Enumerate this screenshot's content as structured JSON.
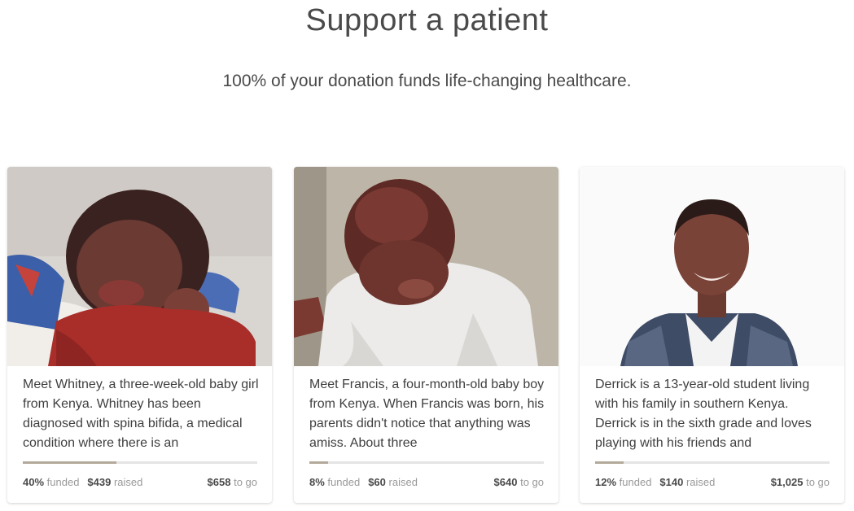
{
  "page": {
    "title": "Support a patient",
    "subtitle": "100% of your donation funds life-changing healthcare."
  },
  "cards": [
    {
      "name": "Whitney",
      "description": "Meet Whitney, a three-week-old baby girl from Kenya. Whitney has been diagnosed with spina bifida, a medical condition where there is an",
      "funded_pct": "40%",
      "funded_label": "funded",
      "raised_amount": "$439",
      "raised_label": "raised",
      "to_go_amount": "$658",
      "to_go_label": "to go",
      "progress_fraction": 0.4
    },
    {
      "name": "Francis",
      "description": "Meet Francis, a four-month-old baby boy from Kenya. When Francis was born, his parents didn't notice that anything was amiss. About three",
      "funded_pct": "8%",
      "funded_label": "funded",
      "raised_amount": "$60",
      "raised_label": "raised",
      "to_go_amount": "$640",
      "to_go_label": "to go",
      "progress_fraction": 0.08
    },
    {
      "name": "Derrick",
      "description": "Derrick is a 13-year-old student living with his family in southern Kenya. Derrick is in the sixth grade and loves playing with his friends and",
      "funded_pct": "12%",
      "funded_label": "funded",
      "raised_amount": "$140",
      "raised_label": "raised",
      "to_go_amount": "$1,025",
      "to_go_label": "to go",
      "progress_fraction": 0.12
    }
  ],
  "colors": {
    "progress_fill": "#b3aa9b",
    "progress_track": "#e4e4e4"
  }
}
